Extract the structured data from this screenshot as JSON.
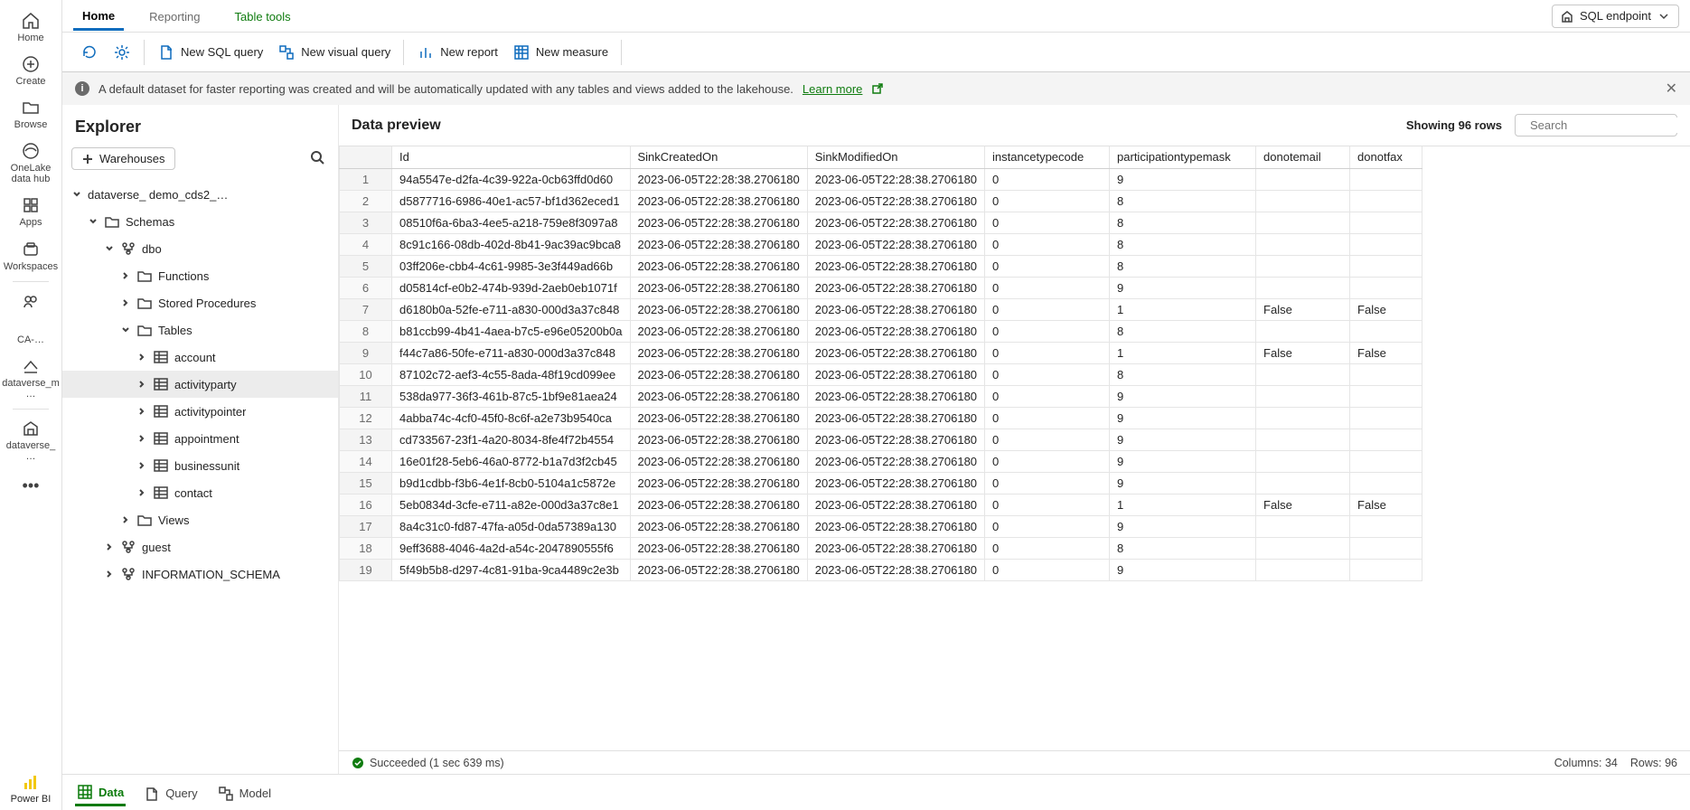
{
  "rail": {
    "items": [
      {
        "label": "Home",
        "name": "rail-home"
      },
      {
        "label": "Create",
        "name": "rail-create"
      },
      {
        "label": "Browse",
        "name": "rail-browse"
      },
      {
        "label": "OneLake data hub",
        "name": "rail-onelake"
      },
      {
        "label": "Apps",
        "name": "rail-apps"
      },
      {
        "label": "Workspaces",
        "name": "rail-workspaces"
      }
    ],
    "extra": [
      {
        "label": "CA-…",
        "name": "rail-ca"
      },
      {
        "label": "dataverse_m…",
        "name": "rail-dataverse-m"
      },
      {
        "label": "dataverse_…",
        "name": "rail-dataverse"
      }
    ],
    "powerbi": "Power BI"
  },
  "toptabs": {
    "items": [
      "Home",
      "Reporting",
      "Table tools"
    ],
    "selected": 0,
    "right_label": "SQL endpoint"
  },
  "toolbar": {
    "new_sql": "New SQL query",
    "new_visual": "New visual query",
    "new_report": "New report",
    "new_measure": "New measure"
  },
  "banner": {
    "text": "A default dataset for faster reporting was created and will be automatically updated with any tables and views added to the lakehouse.",
    "link": "Learn more"
  },
  "explorer": {
    "title": "Explorer",
    "warehouses_btn": "Warehouses",
    "root": "dataverse_           demo_cds2_…",
    "schemas": "Schemas",
    "dbo": "dbo",
    "functions": "Functions",
    "stored": "Stored Procedures",
    "tables": "Tables",
    "table_items": [
      "account",
      "activityparty",
      "activitypointer",
      "appointment",
      "businessunit",
      "contact"
    ],
    "selected_table": "activityparty",
    "views": "Views",
    "guest": "guest",
    "info_schema": "INFORMATION_SCHEMA"
  },
  "preview": {
    "title": "Data preview",
    "showing": "Showing 96 rows",
    "search_placeholder": "Search",
    "columns": [
      "Id",
      "SinkCreatedOn",
      "SinkModifiedOn",
      "instancetypecode",
      "participationtypemask",
      "donotemail",
      "donotfax"
    ],
    "rows": [
      {
        "n": 1,
        "Id": "94a5547e-d2fa-4c39-922a-0cb63ffd0d60",
        "sco": "2023-06-05T22:28:38.2706180",
        "smo": "2023-06-05T22:28:38.2706180",
        "itc": "0",
        "ptm": "9",
        "dne": "",
        "dnf": ""
      },
      {
        "n": 2,
        "Id": "d5877716-6986-40e1-ac57-bf1d362eced1",
        "sco": "2023-06-05T22:28:38.2706180",
        "smo": "2023-06-05T22:28:38.2706180",
        "itc": "0",
        "ptm": "8",
        "dne": "",
        "dnf": ""
      },
      {
        "n": 3,
        "Id": "08510f6a-6ba3-4ee5-a218-759e8f3097a8",
        "sco": "2023-06-05T22:28:38.2706180",
        "smo": "2023-06-05T22:28:38.2706180",
        "itc": "0",
        "ptm": "8",
        "dne": "",
        "dnf": ""
      },
      {
        "n": 4,
        "Id": "8c91c166-08db-402d-8b41-9ac39ac9bca8",
        "sco": "2023-06-05T22:28:38.2706180",
        "smo": "2023-06-05T22:28:38.2706180",
        "itc": "0",
        "ptm": "8",
        "dne": "",
        "dnf": ""
      },
      {
        "n": 5,
        "Id": "03ff206e-cbb4-4c61-9985-3e3f449ad66b",
        "sco": "2023-06-05T22:28:38.2706180",
        "smo": "2023-06-05T22:28:38.2706180",
        "itc": "0",
        "ptm": "8",
        "dne": "",
        "dnf": ""
      },
      {
        "n": 6,
        "Id": "d05814cf-e0b2-474b-939d-2aeb0eb1071f",
        "sco": "2023-06-05T22:28:38.2706180",
        "smo": "2023-06-05T22:28:38.2706180",
        "itc": "0",
        "ptm": "9",
        "dne": "",
        "dnf": ""
      },
      {
        "n": 7,
        "Id": "d6180b0a-52fe-e711-a830-000d3a37c848",
        "sco": "2023-06-05T22:28:38.2706180",
        "smo": "2023-06-05T22:28:38.2706180",
        "itc": "0",
        "ptm": "1",
        "dne": "False",
        "dnf": "False"
      },
      {
        "n": 8,
        "Id": "b81ccb99-4b41-4aea-b7c5-e96e05200b0a",
        "sco": "2023-06-05T22:28:38.2706180",
        "smo": "2023-06-05T22:28:38.2706180",
        "itc": "0",
        "ptm": "8",
        "dne": "",
        "dnf": ""
      },
      {
        "n": 9,
        "Id": "f44c7a86-50fe-e711-a830-000d3a37c848",
        "sco": "2023-06-05T22:28:38.2706180",
        "smo": "2023-06-05T22:28:38.2706180",
        "itc": "0",
        "ptm": "1",
        "dne": "False",
        "dnf": "False"
      },
      {
        "n": 10,
        "Id": "87102c72-aef3-4c55-8ada-48f19cd099ee",
        "sco": "2023-06-05T22:28:38.2706180",
        "smo": "2023-06-05T22:28:38.2706180",
        "itc": "0",
        "ptm": "8",
        "dne": "",
        "dnf": ""
      },
      {
        "n": 11,
        "Id": "538da977-36f3-461b-87c5-1bf9e81aea24",
        "sco": "2023-06-05T22:28:38.2706180",
        "smo": "2023-06-05T22:28:38.2706180",
        "itc": "0",
        "ptm": "9",
        "dne": "",
        "dnf": ""
      },
      {
        "n": 12,
        "Id": "4abba74c-4cf0-45f0-8c6f-a2e73b9540ca",
        "sco": "2023-06-05T22:28:38.2706180",
        "smo": "2023-06-05T22:28:38.2706180",
        "itc": "0",
        "ptm": "9",
        "dne": "",
        "dnf": ""
      },
      {
        "n": 13,
        "Id": "cd733567-23f1-4a20-8034-8fe4f72b4554",
        "sco": "2023-06-05T22:28:38.2706180",
        "smo": "2023-06-05T22:28:38.2706180",
        "itc": "0",
        "ptm": "9",
        "dne": "",
        "dnf": ""
      },
      {
        "n": 14,
        "Id": "16e01f28-5eb6-46a0-8772-b1a7d3f2cb45",
        "sco": "2023-06-05T22:28:38.2706180",
        "smo": "2023-06-05T22:28:38.2706180",
        "itc": "0",
        "ptm": "9",
        "dne": "",
        "dnf": ""
      },
      {
        "n": 15,
        "Id": "b9d1cdbb-f3b6-4e1f-8cb0-5104a1c5872e",
        "sco": "2023-06-05T22:28:38.2706180",
        "smo": "2023-06-05T22:28:38.2706180",
        "itc": "0",
        "ptm": "9",
        "dne": "",
        "dnf": ""
      },
      {
        "n": 16,
        "Id": "5eb0834d-3cfe-e711-a82e-000d3a37c8e1",
        "sco": "2023-06-05T22:28:38.2706180",
        "smo": "2023-06-05T22:28:38.2706180",
        "itc": "0",
        "ptm": "1",
        "dne": "False",
        "dnf": "False"
      },
      {
        "n": 17,
        "Id": "8a4c31c0-fd87-47fa-a05d-0da57389a130",
        "sco": "2023-06-05T22:28:38.2706180",
        "smo": "2023-06-05T22:28:38.2706180",
        "itc": "0",
        "ptm": "9",
        "dne": "",
        "dnf": ""
      },
      {
        "n": 18,
        "Id": "9eff3688-4046-4a2d-a54c-2047890555f6",
        "sco": "2023-06-05T22:28:38.2706180",
        "smo": "2023-06-05T22:28:38.2706180",
        "itc": "0",
        "ptm": "8",
        "dne": "",
        "dnf": ""
      },
      {
        "n": 19,
        "Id": "5f49b5b8-d297-4c81-91ba-9ca4489c2e3b",
        "sco": "2023-06-05T22:28:38.2706180",
        "smo": "2023-06-05T22:28:38.2706180",
        "itc": "0",
        "ptm": "9",
        "dne": "",
        "dnf": ""
      }
    ],
    "status_succeeded": "Succeeded (1 sec 639 ms)",
    "columns_count": "Columns: 34",
    "rows_count": "Rows: 96"
  },
  "btabs": {
    "items": [
      "Data",
      "Query",
      "Model"
    ],
    "selected": 0
  }
}
